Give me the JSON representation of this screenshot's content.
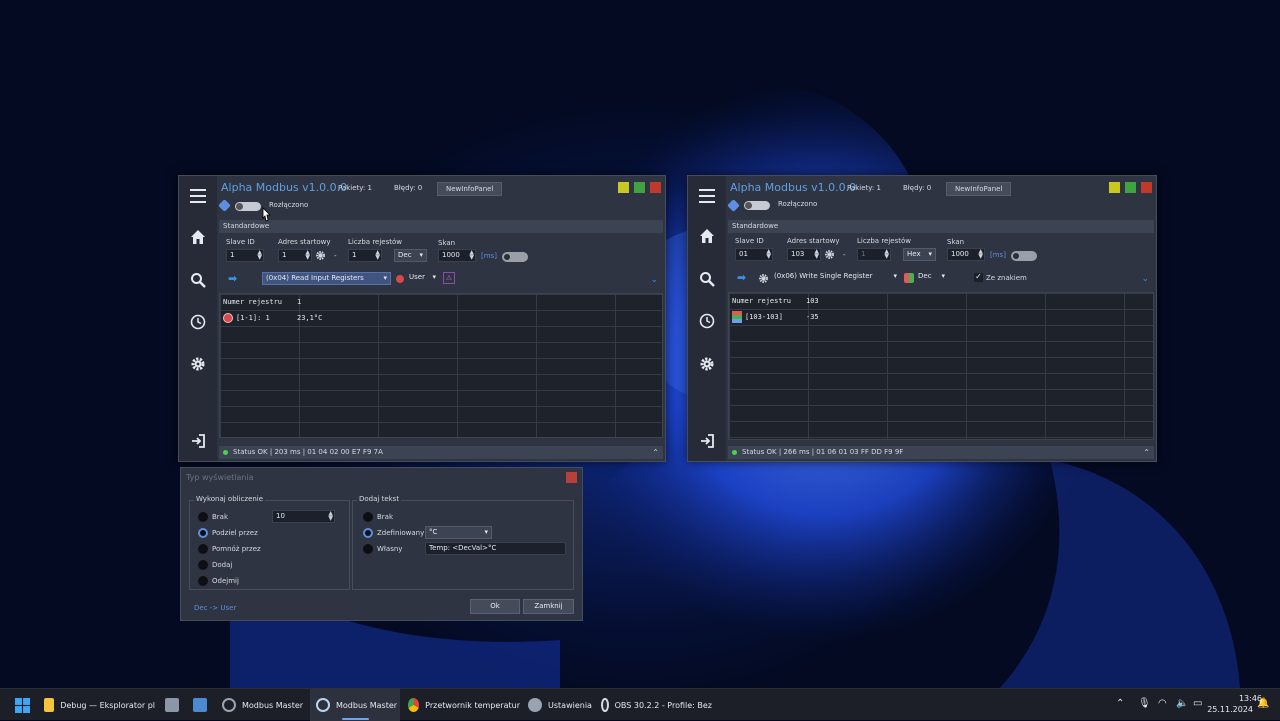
{
  "window1": {
    "title": "Alpha Modbus v1.0.0.0",
    "packets": "Pakiety: 1",
    "errors": "Błędy: 0",
    "newinfo": "NewInfoPanel",
    "conn_status": "Rozłączono",
    "section": "Standardowe",
    "slave_label": "Slave ID",
    "slave_value": "1",
    "addr_label": "Adres startowy",
    "addr_value": "1",
    "dash": "-",
    "count_label": "Liczba rejestów",
    "count_value": "1",
    "format_value": "Dec",
    "scan_label": "Skan",
    "scan_value": "1000",
    "scan_unit": "[ms]",
    "function_value": "(0x04) Read Input Registers",
    "display_value": "User",
    "grid_header": "Numer rejestru",
    "grid_header_val": "1",
    "row_label": "[1-1]: 1",
    "row_value": "23,1°C",
    "status": "Status OK | 203 ms | 01 04 02 00 E7 F9 7A"
  },
  "window2": {
    "title": "Alpha Modbus v1.0.0.0",
    "packets": "Pakiety: 1",
    "errors": "Błędy: 0",
    "newinfo": "NewInfoPanel",
    "conn_status": "Rozłączono",
    "section": "Standardowe",
    "slave_label": "Slave ID",
    "slave_value": "01",
    "addr_label": "Adres startowy",
    "addr_value": "103",
    "dash": "-",
    "count_label": "Liczba rejestów",
    "count_value": "1",
    "format_value": "Hex",
    "scan_label": "Skan",
    "scan_value": "1000",
    "scan_unit": "[ms]",
    "function_value": "(0x06) Write Single Register",
    "display_value": "Dec",
    "signed_label": "Ze znakiem",
    "grid_header": "Numer rejestru",
    "grid_header_val": "103",
    "row_label": "[103-103]",
    "row_value": "-35",
    "status": "Status OK | 266 ms | 01 06 01 03 FF DD F9 9F"
  },
  "dialog": {
    "title": "Typ wyświetlania",
    "calc_group": "Wykonaj obliczenie",
    "calc_options": [
      "Brak",
      "Podziel przez",
      "Pomnóż przez",
      "Dodaj",
      "Odejmij"
    ],
    "calc_value": "10",
    "text_group": "Dodaj tekst",
    "text_options": [
      "Brak",
      "Zdefiniowany",
      "Własny"
    ],
    "defined_value": "°C",
    "custom_value": "Temp: <DecVal>°C",
    "mode": "Dec -> User",
    "ok": "Ok",
    "close": "Zamknij"
  },
  "taskbar": {
    "items": [
      "Debug — Eksplorator pl",
      "Modbus Master",
      "Modbus Master",
      "Przetwornik temperatur",
      "Ustawienia",
      "OBS 30.2.2 - Profile: Bez"
    ],
    "time": "13:46",
    "date": "25.11.2024"
  },
  "colors": {
    "accent": "#5e9fe4",
    "ok": "#4cd24c",
    "close": "#c0392b",
    "min": "#c8c81e",
    "max": "#3fa33f"
  },
  "icons": [
    "menu-icon",
    "home-icon",
    "search-icon",
    "clock-icon",
    "gear-icon",
    "logout-icon",
    "arrow-right-icon",
    "chevron-down-icon",
    "chevron-up-icon"
  ]
}
